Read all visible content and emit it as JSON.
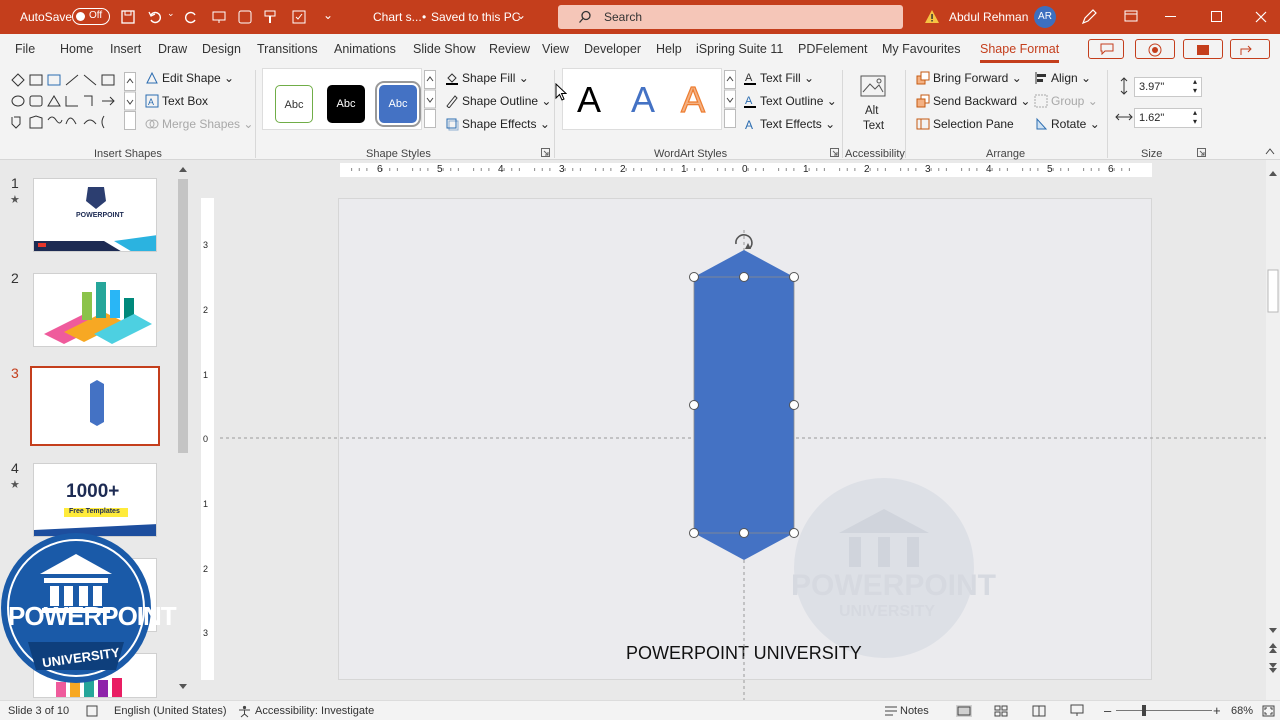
{
  "titlebar": {
    "autosave_label": "AutoSave",
    "autosave_state": "Off",
    "doc_title": "Chart s...",
    "save_status": "Saved to this PC",
    "search_placeholder": "Search",
    "user_name": "Abdul Rehman",
    "user_initials": "AR"
  },
  "tabs": [
    "File",
    "Home",
    "Insert",
    "Draw",
    "Design",
    "Transitions",
    "Animations",
    "Slide Show",
    "Review",
    "View",
    "Developer",
    "Help",
    "iSpring Suite 11",
    "PDFelement",
    "My Favourites",
    "Shape Format"
  ],
  "ribbon": {
    "insert_shapes": {
      "edit_shape": "Edit Shape",
      "text_box": "Text Box",
      "merge_shapes": "Merge Shapes",
      "group_label": "Insert Shapes"
    },
    "shape_styles": {
      "thumb_labels": [
        "Abc",
        "Abc",
        "Abc"
      ],
      "shape_fill": "Shape Fill",
      "shape_outline": "Shape Outline",
      "shape_effects": "Shape Effects",
      "group_label": "Shape Styles"
    },
    "wordart_styles": {
      "letters": [
        "A",
        "A",
        "A"
      ],
      "text_fill": "Text Fill",
      "text_outline": "Text Outline",
      "text_effects": "Text Effects",
      "group_label": "WordArt Styles"
    },
    "accessibility": {
      "alt_text_line1": "Alt",
      "alt_text_line2": "Text",
      "group_label": "Accessibility"
    },
    "arrange": {
      "bring_forward": "Bring Forward",
      "send_backward": "Send Backward",
      "selection_pane": "Selection Pane",
      "align": "Align",
      "group": "Group",
      "rotate": "Rotate",
      "group_label": "Arrange"
    },
    "size": {
      "height": "3.97\"",
      "width": "1.62\"",
      "group_label": "Size"
    }
  },
  "slides": [
    {
      "num": "1",
      "star": "★",
      "thumb_text": "POWERPOINT"
    },
    {
      "num": "2",
      "star": "",
      "thumb_text": ""
    },
    {
      "num": "3",
      "star": "",
      "thumb_text": ""
    },
    {
      "num": "4",
      "star": "★",
      "thumb_text": "1000+",
      "thumb_sub": "Free Templates"
    }
  ],
  "rulers": {
    "h_labels": [
      "6",
      "5",
      "4",
      "3",
      "2",
      "1",
      "0",
      "1",
      "2",
      "3",
      "4",
      "5",
      "6"
    ],
    "v_labels": [
      "3",
      "2",
      "1",
      "0",
      "1",
      "2",
      "3"
    ]
  },
  "slide_content": {
    "footer_text": "POWERPOINT UNIVERSITY",
    "shape_color": "#4472c4"
  },
  "watermark": {
    "line1": "POWERPOINT",
    "line2": "UNIVERSITY"
  },
  "status": {
    "slide_info": "Slide 3 of 10",
    "language": "English (United States)",
    "accessibility": "Accessibility: Investigate",
    "notes": "Notes",
    "zoom": "68%"
  },
  "colors": {
    "accent": "#c43e1c",
    "shape": "#4472c4"
  }
}
